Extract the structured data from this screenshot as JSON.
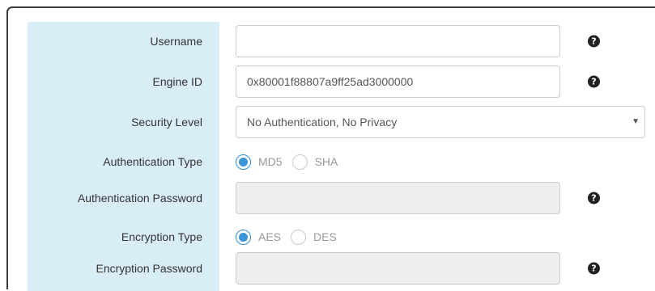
{
  "form": {
    "username": {
      "label": "Username",
      "value": "",
      "help_icon": "question-circle-icon"
    },
    "engine_id": {
      "label": "Engine ID",
      "value": "0x80001f88807a9ff25ad3000000",
      "help_icon": "question-circle-icon"
    },
    "security_level": {
      "label": "Security Level",
      "selected": "No Authentication, No Privacy",
      "caret_icon": "caret-down-icon"
    },
    "auth_type": {
      "label": "Authentication Type",
      "options": [
        {
          "label": "MD5",
          "checked": true
        },
        {
          "label": "SHA",
          "checked": false
        }
      ]
    },
    "auth_password": {
      "label": "Authentication Password",
      "value": "",
      "disabled": true,
      "help_icon": "question-circle-icon"
    },
    "enc_type": {
      "label": "Encryption Type",
      "options": [
        {
          "label": "AES",
          "checked": true
        },
        {
          "label": "DES",
          "checked": false
        }
      ]
    },
    "enc_password": {
      "label": "Encryption Password",
      "value": "",
      "disabled": true,
      "help_icon": "question-circle-icon"
    }
  },
  "colors": {
    "label_column_bg": "#d9edf7",
    "radio_accent": "#3d95d9",
    "disabled_field_bg": "#eeeeee"
  }
}
